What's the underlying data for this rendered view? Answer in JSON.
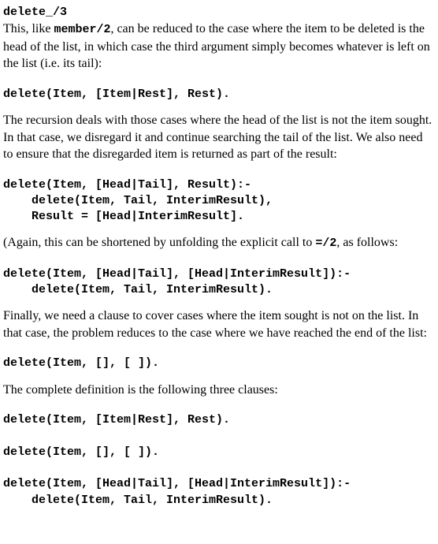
{
  "heading": "delete_/3",
  "paragraphs": {
    "p1a": "This, like ",
    "p1_code": "member/2",
    "p1b": ", can be reduced to the case where the item to be deleted is the head of the list, in which case the third argument simply becomes whatever is left on the list (i.e. its tail):",
    "p2": "The recursion deals with those cases where the head of the list is not the item sought. In that case, we disregard it and continue searching the tail of the list. We also need to ensure that the disregarded item is returned as part of the result:",
    "p3a": "(Again, this can be shortened by unfolding the explicit call to ",
    "p3_code": "=/2",
    "p3b": ", as follows:",
    "p4": "Finally, we need a clause to cover cases where the item sought is not on the list. In that case, the problem reduces to the case where we have reached the end of the list:",
    "p5": "The complete definition is the following three clauses:"
  },
  "code": {
    "c1": "delete(Item, [Item|Rest], Rest).",
    "c2": "delete(Item, [Head|Tail], Result):-\n    delete(Item, Tail, InterimResult),\n    Result = [Head|InterimResult].",
    "c3": "delete(Item, [Head|Tail], [Head|InterimResult]):-\n    delete(Item, Tail, InterimResult).",
    "c4": "delete(Item, [], [ ]).",
    "c5": "delete(Item, [Item|Rest], Rest).\n\ndelete(Item, [], [ ]).\n\ndelete(Item, [Head|Tail], [Head|InterimResult]):-\n    delete(Item, Tail, InterimResult)."
  }
}
